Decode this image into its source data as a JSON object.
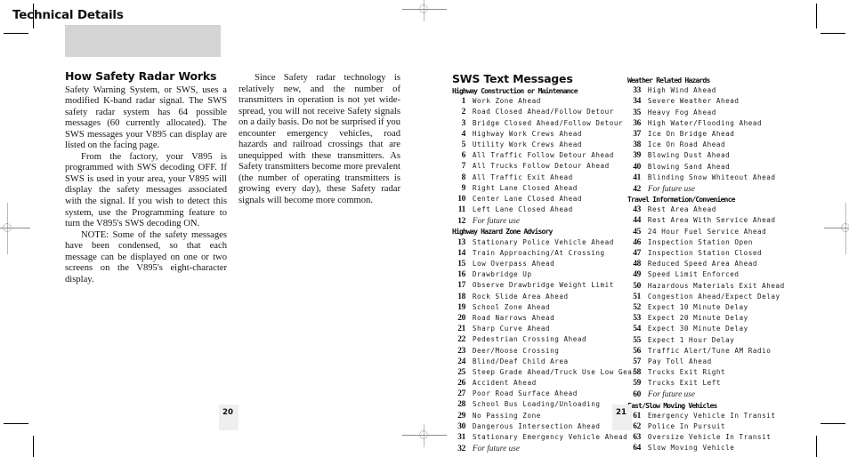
{
  "banner": {
    "title": "Technical Details"
  },
  "left_page": {
    "page_number": "20",
    "heading": "How Safety Radar Works",
    "paragraphs": [
      "Safety Warning System, or SWS, uses a modified K-band radar signal. The SWS safety radar system has 64 possible messages (60 currently allocated). The SWS messages your V895 can display are listed on the facing page.",
      "From the factory, your V895 is programmed with SWS decoding OFF. If SWS is used in your area, your V895 will display the safety messages associated with the signal. If you wish to detect this system, use the Programming feature to turn the V895's SWS decoding ON.",
      "NOTE: Some of the safety messages have been condensed, so that each message can be displayed on one or two screens on the V895's eight-character display."
    ],
    "paragraphs_col2": [
      "Since Safety radar technology is relatively new, and the number of transmitters in operation is not yet wide-spread, you will not receive Safety signals on a daily basis. Do not be surprised if you encounter emergency vehicles, road hazards and railroad crossings that are unequipped with these transmitters. As Safety transmitters become more prevalent (the number of operating transmitters is growing every day), these Safety radar signals will become more common."
    ]
  },
  "right_page": {
    "page_number": "21",
    "title": "SWS Text Messages",
    "column_a": [
      {
        "group": "Highway Construction or Maintenance",
        "items": [
          {
            "num": "1",
            "text": "Work Zone Ahead"
          },
          {
            "num": "2",
            "text": "Road Closed Ahead/Follow Detour"
          },
          {
            "num": "3",
            "text": "Bridge Closed Ahead/Follow Detour"
          },
          {
            "num": "4",
            "text": "Highway Work Crews Ahead"
          },
          {
            "num": "5",
            "text": "Utility Work Crews Ahead"
          },
          {
            "num": "6",
            "text": "All Traffic Follow Detour Ahead"
          },
          {
            "num": "7",
            "text": "All Trucks Follow Detour Ahead"
          },
          {
            "num": "8",
            "text": "All Traffic Exit Ahead"
          },
          {
            "num": "9",
            "text": "Right Lane Closed Ahead"
          },
          {
            "num": "10",
            "text": "Center Lane Closed Ahead"
          },
          {
            "num": "11",
            "text": "Left Lane Closed Ahead"
          },
          {
            "num": "12",
            "text": "For future use",
            "future": true
          }
        ]
      },
      {
        "group": "Highway Hazard Zone Advisory",
        "items": [
          {
            "num": "13",
            "text": "Stationary Police Vehicle Ahead"
          },
          {
            "num": "14",
            "text": "Train Approaching/At Crossing"
          },
          {
            "num": "15",
            "text": "Low Overpass Ahead"
          },
          {
            "num": "16",
            "text": "Drawbridge Up"
          },
          {
            "num": "17",
            "text": "Observe Drawbridge Weight Limit"
          },
          {
            "num": "18",
            "text": "Rock Slide Area Ahead"
          },
          {
            "num": "19",
            "text": "School Zone Ahead"
          },
          {
            "num": "20",
            "text": "Road Narrows Ahead"
          },
          {
            "num": "21",
            "text": "Sharp Curve Ahead"
          },
          {
            "num": "22",
            "text": "Pedestrian Crossing Ahead"
          },
          {
            "num": "23",
            "text": "Deer/Moose Crossing"
          },
          {
            "num": "24",
            "text": "Blind/Deaf Child Area"
          },
          {
            "num": "25",
            "text": "Steep Grade Ahead/Truck Use Low Gear"
          },
          {
            "num": "26",
            "text": "Accident Ahead"
          },
          {
            "num": "27",
            "text": "Poor Road Surface Ahead"
          },
          {
            "num": "28",
            "text": "School Bus Loading/Unloading"
          },
          {
            "num": "29",
            "text": "No Passing Zone"
          },
          {
            "num": "30",
            "text": "Dangerous Intersection Ahead"
          },
          {
            "num": "31",
            "text": "Stationary Emergency Vehicle Ahead"
          },
          {
            "num": "32",
            "text": "For future use",
            "future": true
          }
        ]
      }
    ],
    "column_b": [
      {
        "group": "Weather Related Hazards",
        "items": [
          {
            "num": "33",
            "text": "High Wind Ahead"
          },
          {
            "num": "34",
            "text": "Severe Weather Ahead"
          },
          {
            "num": "35",
            "text": "Heavy Fog Ahead"
          },
          {
            "num": "36",
            "text": "High Water/Flooding Ahead"
          },
          {
            "num": "37",
            "text": "Ice On Bridge Ahead"
          },
          {
            "num": "38",
            "text": "Ice On Road Ahead"
          },
          {
            "num": "39",
            "text": "Blowing Dust Ahead"
          },
          {
            "num": "40",
            "text": "Blowing Sand Ahead"
          },
          {
            "num": "41",
            "text": "Blinding Snow Whiteout Ahead"
          },
          {
            "num": "42",
            "text": "For future use",
            "future": true
          }
        ]
      },
      {
        "group": "Travel Information/Convenience",
        "items": [
          {
            "num": "43",
            "text": "Rest Area Ahead"
          },
          {
            "num": "44",
            "text": "Rest Area With Service Ahead"
          },
          {
            "num": "45",
            "text": "24 Hour Fuel Service Ahead"
          },
          {
            "num": "46",
            "text": "Inspection Station Open"
          },
          {
            "num": "47",
            "text": "Inspection Station Closed"
          },
          {
            "num": "48",
            "text": "Reduced Speed Area Ahead"
          },
          {
            "num": "49",
            "text": "Speed Limit Enforced"
          },
          {
            "num": "50",
            "text": "Hazardous Materials Exit Ahead"
          },
          {
            "num": "51",
            "text": "Congestion Ahead/Expect Delay"
          },
          {
            "num": "52",
            "text": "Expect 10 Minute Delay"
          },
          {
            "num": "53",
            "text": "Expect 20 Minute Delay"
          },
          {
            "num": "54",
            "text": "Expect 30 Minute Delay"
          },
          {
            "num": "55",
            "text": "Expect 1 Hour Delay"
          },
          {
            "num": "56",
            "text": "Traffic Alert/Tune AM Radio"
          },
          {
            "num": "57",
            "text": "Pay Toll Ahead"
          },
          {
            "num": "58",
            "text": "Trucks Exit Right"
          },
          {
            "num": "59",
            "text": "Trucks Exit Left"
          },
          {
            "num": "60",
            "text": "For future use",
            "future": true
          }
        ]
      },
      {
        "group": "Fast/Slow Moving Vehicles",
        "items": [
          {
            "num": "61",
            "text": "Emergency Vehicle In Transit"
          },
          {
            "num": "62",
            "text": "Police In Pursuit"
          },
          {
            "num": "63",
            "text": "Oversize Vehicle In Transit"
          },
          {
            "num": "64",
            "text": "Slow Moving Vehicle"
          }
        ]
      }
    ]
  },
  "colors": {
    "banner_bg": "#d4d4d4",
    "pagenum_bg": "#efefef",
    "text": "#1a1a1a",
    "regmark": "#8a8a8a"
  }
}
